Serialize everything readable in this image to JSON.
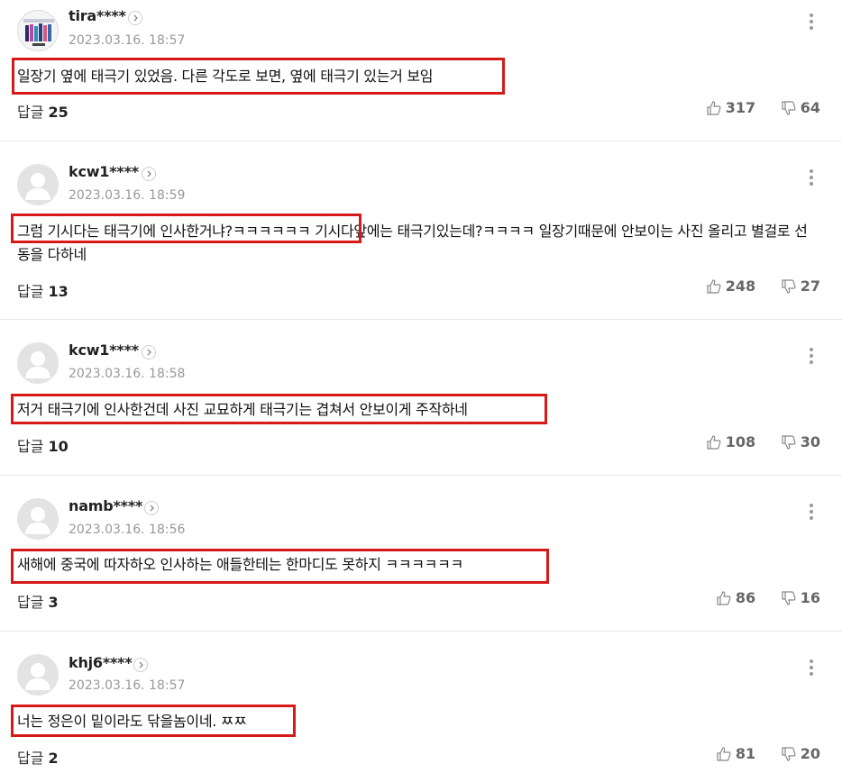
{
  "reply_label": "답글",
  "comments": [
    {
      "nick": "tira****",
      "date": "2023.03.16. 18:57",
      "text": "일장기 옆에 태극기 있었음. 다른 각도로 보면, 옆에 태극기 있는거 보임",
      "reply_count": "25",
      "likes": "317",
      "dislikes": "64",
      "avatar": "photo"
    },
    {
      "nick": "kcw1****",
      "date": "2023.03.16. 18:59",
      "text": "그럼 기시다는 태극기에 인사한거냐?ㅋㅋㅋㅋㅋㅋ 기시다앞에는 태극기있는데?ㅋㅋㅋㅋ 일장기때문에 안보이는 사진 올리고 별걸로 선동을 다하네",
      "reply_count": "13",
      "likes": "248",
      "dislikes": "27",
      "avatar": "default"
    },
    {
      "nick": "kcw1****",
      "date": "2023.03.16. 18:58",
      "text": "저거 태극기에 인사한건데 사진 교묘하게 태극기는 겹쳐서 안보이게 주작하네",
      "reply_count": "10",
      "likes": "108",
      "dislikes": "30",
      "avatar": "default"
    },
    {
      "nick": "namb****",
      "date": "2023.03.16. 18:56",
      "text": "새해에 중국에 따자하오 인사하는 애들한테는 한마디도 못하지 ㅋㅋㅋㅋㅋㅋ",
      "reply_count": "3",
      "likes": "86",
      "dislikes": "16",
      "avatar": "default"
    },
    {
      "nick": "khj6****",
      "date": "2023.03.16. 18:57",
      "text": "너는 정은이 밑이라도 닦을놈이네. ㅉㅉ",
      "reply_count": "2",
      "likes": "81",
      "dislikes": "20",
      "avatar": "default"
    }
  ],
  "icons": {
    "more": "more-vertical-icon",
    "profile_link": "chevron-right-icon",
    "like": "thumbs-up-icon",
    "dislike": "thumbs-down-icon",
    "default_avatar": "default-user-icon"
  },
  "colors": {
    "highlight_box": "#d61a1a",
    "muted_text": "#999999",
    "separator": "#e8e8e8"
  }
}
